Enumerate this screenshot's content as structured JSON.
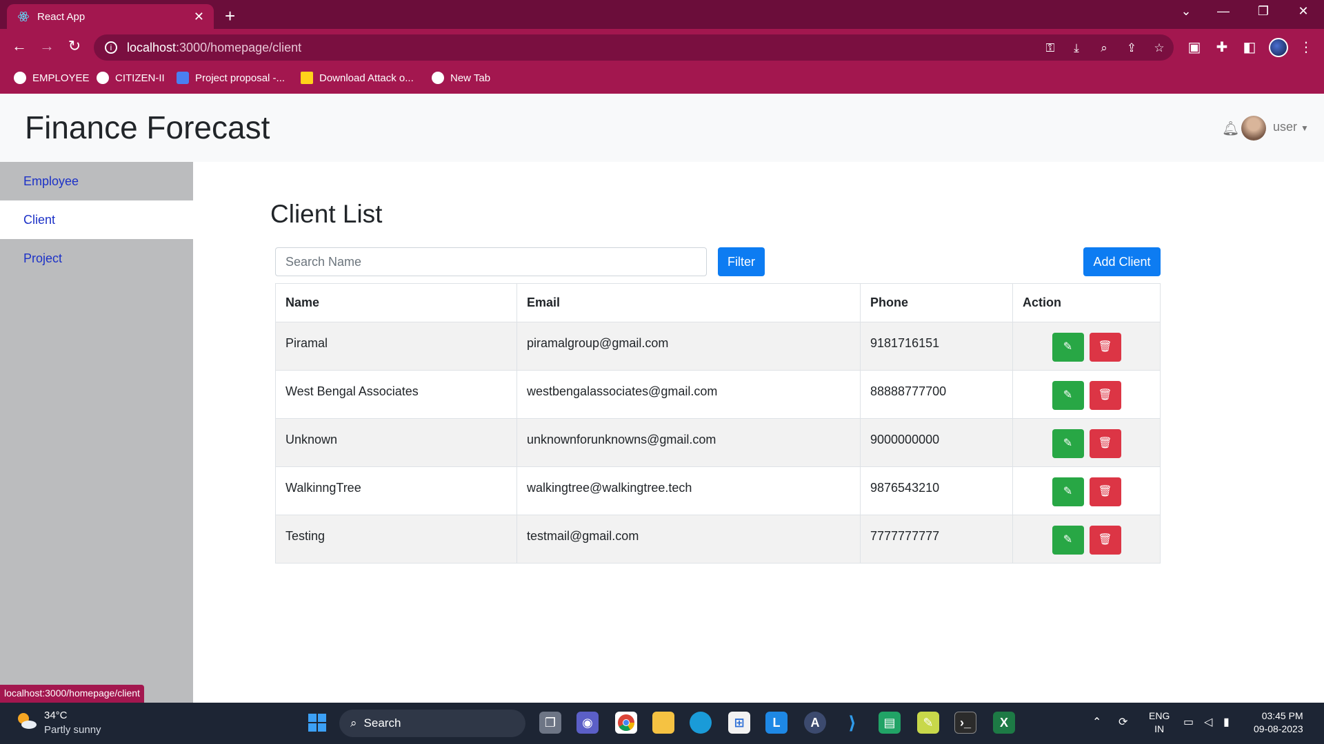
{
  "browser": {
    "tab_title": "React App",
    "url_host": "localhost",
    "url_path": ":3000/homepage/client",
    "bookmarks": [
      {
        "label": "EMPLOYEE"
      },
      {
        "label": "CITIZEN-II"
      },
      {
        "label": "Project proposal -..."
      },
      {
        "label": "Download Attack o..."
      },
      {
        "label": "New Tab"
      }
    ],
    "status_url": "localhost:3000/homepage/client"
  },
  "app": {
    "title": "Finance Forecast",
    "user_label": "user"
  },
  "sidebar": {
    "items": [
      {
        "label": "Employee"
      },
      {
        "label": "Client"
      },
      {
        "label": "Project"
      }
    ]
  },
  "main": {
    "heading": "Client List",
    "search_placeholder": "Search Name",
    "filter_label": "Filter",
    "add_label": "Add Client",
    "columns": [
      "Name",
      "Email",
      "Phone",
      "Action"
    ],
    "rows": [
      {
        "name": "Piramal",
        "email": "piramalgroup@gmail.com",
        "phone": "9181716151"
      },
      {
        "name": "West Bengal Associates",
        "email": "westbengalassociates@gmail.com",
        "phone": "88888777700"
      },
      {
        "name": "Unknown",
        "email": "unknownforunknowns@gmail.com",
        "phone": "9000000000"
      },
      {
        "name": "WalkinngTree",
        "email": "walkingtree@walkingtree.tech",
        "phone": "9876543210"
      },
      {
        "name": "Testing",
        "email": "testmail@gmail.com",
        "phone": "7777777777"
      }
    ]
  },
  "taskbar": {
    "temperature": "34°C",
    "weather": "Partly sunny",
    "search_label": "Search",
    "lang_line1": "ENG",
    "lang_line2": "IN",
    "time": "03:45 PM",
    "date": "09-08-2023"
  },
  "colors": {
    "browser_frame": "#a3174f",
    "primary": "#0d7cf2",
    "edit": "#28a745",
    "delete": "#dc3545",
    "sidebar": "#bbbcbe"
  }
}
